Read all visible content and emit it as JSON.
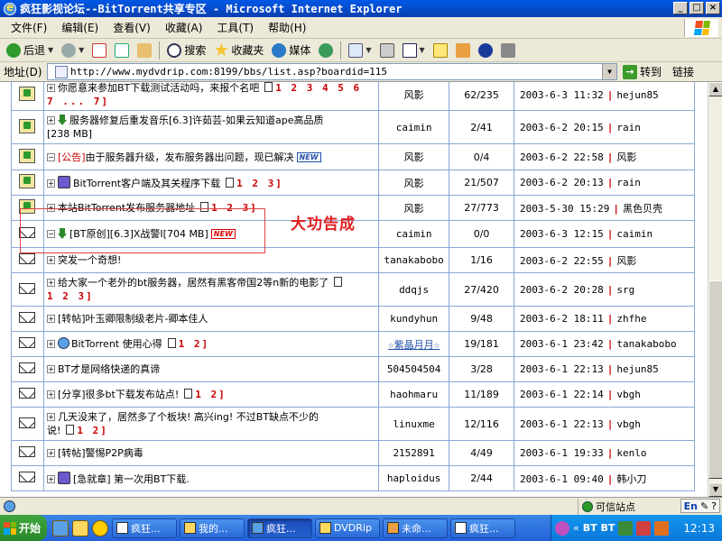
{
  "window": {
    "title": "疯狂影视论坛--BitTorrent共享专区 - Microsoft Internet Explorer",
    "min": "_",
    "max": "□",
    "close": "×"
  },
  "menu": [
    "文件(F)",
    "编辑(E)",
    "查看(V)",
    "收藏(A)",
    "工具(T)",
    "帮助(H)"
  ],
  "toolbar": {
    "back": "后退",
    "search": "搜索",
    "favorites": "收藏夹",
    "media": "媒体"
  },
  "address": {
    "label": "地址(D)",
    "url": "http://www.mydvdrip.com:8199/bbs/list.asp?boardid=115",
    "go": "转到",
    "links": "链接"
  },
  "threads": [
    {
      "icon": "hot",
      "title_lines": [
        "你愿意来参加BT下载测试活动吗，来报个名吧"
      ],
      "pages": "1 2 3 4 5 6",
      "pages2": "7 ... 7",
      "author": "风影",
      "count": "62/235",
      "last_time": "2003-6-3 11:32",
      "last_user": "hejun85"
    },
    {
      "icon": "hot",
      "title": "服务器修复后重发音乐[6.3]许茹芸-如果云知道ape高品质",
      "title2": "[238 MB]",
      "author": "caimin",
      "count": "2/41",
      "last_time": "2003-6-2 20:15",
      "last_user": "rain"
    },
    {
      "icon": "hot",
      "tag": "[公告]",
      "title": "由于服务器升级，发布服务器出问题，现已解决",
      "author": "风影",
      "count": "0/4",
      "last_time": "2003-6-2 22:58",
      "last_user": "风影"
    },
    {
      "icon": "hot",
      "title": "BitTorrent客户端及其关程序下载",
      "pages": "1 2 3",
      "author": "风影",
      "count": "21/507",
      "last_time": "2003-6-2 20:13",
      "last_user": "rain"
    },
    {
      "icon": "hot",
      "title": "本站BitTorrent发布服务器地址",
      "pages": "1 2 3",
      "author": "风影",
      "count": "27/773",
      "last_time": "2003-5-30 15:29",
      "last_user": "黑色贝壳"
    },
    {
      "icon": "mail",
      "title": "[BT原创][6.3]X战警I[704 MB]",
      "badge": "NEW",
      "author": "caimin",
      "count": "0/0",
      "last_time": "2003-6-3 12:15",
      "last_user": "caimin"
    },
    {
      "icon": "mail",
      "title": "突发一个奇想!",
      "author": "tanakabobo",
      "count": "1/16",
      "last_time": "2003-6-2 22:55",
      "last_user": "风影"
    },
    {
      "icon": "mail-new",
      "title": "给大家一个老外的bt服务器，居然有黑客帝国2等n新的电影了",
      "pages": "1 2 3",
      "author": "ddqjs",
      "count": "27/420",
      "last_time": "2003-6-2 20:28",
      "last_user": "srg"
    },
    {
      "icon": "mail",
      "title": "[转帖]叶玉卿限制级老片-卿本佳人",
      "author": "kundyhun",
      "count": "9/48",
      "last_time": "2003-6-2 18:11",
      "last_user": "zhfhe"
    },
    {
      "icon": "mail",
      "title": "BitTorrent 使用心得",
      "pages": "1 2",
      "author": "☆紫晶月月☆",
      "count": "19/181",
      "last_time": "2003-6-1 23:42",
      "last_user": "tanakabobo"
    },
    {
      "icon": "mail",
      "title": "BT才是网络快递的真谛",
      "author": "504504504",
      "count": "3/28",
      "last_time": "2003-6-1 22:13",
      "last_user": "hejun85"
    },
    {
      "icon": "mail",
      "title": "[分享]很多bt下载发布站点!",
      "pages": "1 2",
      "author": "haohmaru",
      "count": "11/189",
      "last_time": "2003-6-1 22:14",
      "last_user": "vbgh"
    },
    {
      "icon": "mail",
      "title": "几天没来了，居然多了个板块! 高兴ing! 不过BT缺点不少的",
      "title2": "说!",
      "pages": "1 2",
      "author": "linuxme",
      "count": "12/116",
      "last_time": "2003-6-1 22:13",
      "last_user": "vbgh"
    },
    {
      "icon": "mail",
      "title": "[转帖]警惕P2P病毒",
      "author": "2152891",
      "count": "4/49",
      "last_time": "2003-6-1 19:33",
      "last_user": "kenlo"
    },
    {
      "icon": "mail",
      "title": "[急就章] 第一次用BT下载.",
      "author": "haploidus",
      "count": "2/44",
      "last_time": "2003-6-1 09:40",
      "last_user": "韩小刀"
    }
  ],
  "annotation": "大功告成",
  "status": {
    "zone": "可信站点",
    "lang": "En"
  },
  "taskbar": {
    "start": "开始",
    "tasks": [
      "疯狂...",
      "我的...",
      "疯狂...",
      "DVDRip",
      "未命...",
      "疯狂..."
    ],
    "tray_text": "BT BT",
    "clock": "12:13"
  }
}
